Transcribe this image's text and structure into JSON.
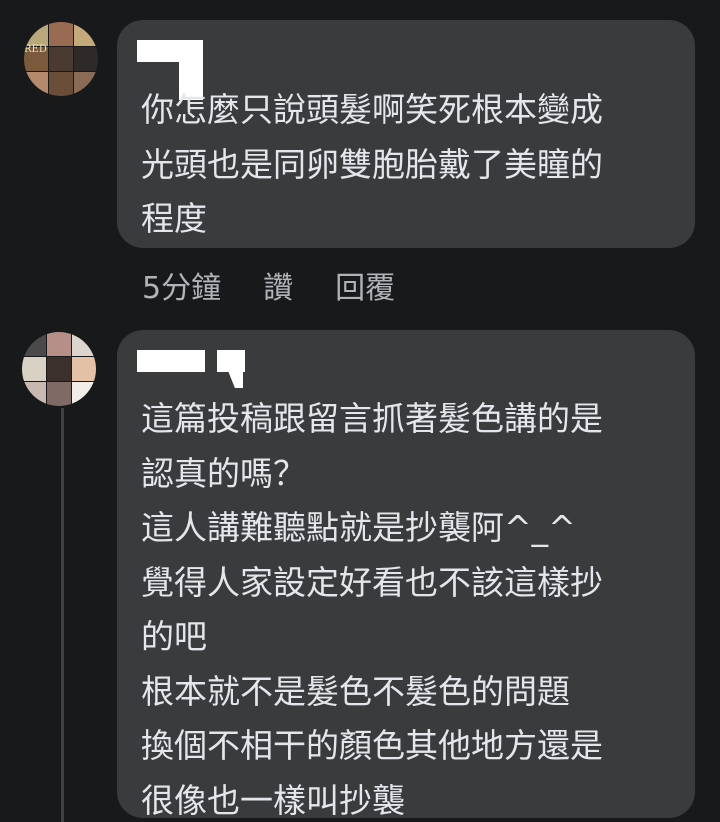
{
  "comments": [
    {
      "avatar_text": "RED",
      "avatar_tiles": [
        "#b9a97a",
        "#9a6b53",
        "#c4a97a",
        "#7b5a3c",
        "#4a3a32",
        "#2e2a2a",
        "#b48a6a",
        "#6b4e3a",
        "#8a6b55"
      ],
      "lines": [
        "你怎麼只說頭髮啊笑死根本變成",
        "光頭也是同卵雙胞胎戴了美瞳的",
        "程度"
      ],
      "actions": {
        "time": "5分鐘",
        "like": "讚",
        "reply": "回覆"
      }
    },
    {
      "avatar_tiles": [
        "#4a4a4a",
        "#b58f88",
        "#dcd5cf",
        "#d9d2c4",
        "#3b302b",
        "#e3c1a6",
        "#c9b8b1",
        "#7f6a66",
        "#f1ede8"
      ],
      "lines": [
        "這篇投稿跟留言抓著髮色講的是",
        "認真的嗎？",
        "這人講難聽點就是抄襲阿^_^",
        "覺得人家設定好看也不該這樣抄",
        "的吧",
        "根本就不是髮色不髮色的問題",
        "換個不相干的顏色其他地方還是",
        "很像也一樣叫抄襲"
      ]
    }
  ],
  "colors": {
    "background": "#18191a",
    "bubble": "#3a3b3c",
    "text": "#e4e6eb",
    "secondary_text": "#b0b3b8"
  }
}
